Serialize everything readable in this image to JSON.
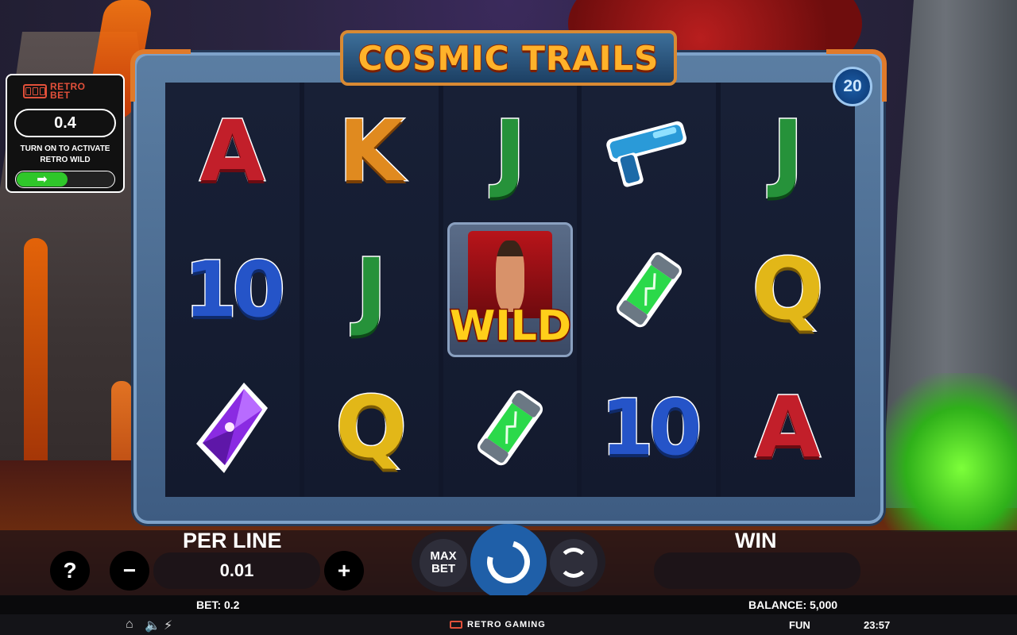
{
  "game": {
    "title": "COSMIC TRAILS",
    "lines": "20"
  },
  "retro_panel": {
    "brand_line1": "RETRO",
    "brand_line2": "BET",
    "value": "0.4",
    "note_line1": "TURN ON TO ACTIVATE",
    "note_line2": "RETRO WILD",
    "toggle_arrow": "➡"
  },
  "reels": [
    [
      "A",
      "10",
      "gem-icon"
    ],
    [
      "K",
      "J",
      "Q"
    ],
    [
      "J",
      "WILD",
      "canister-icon"
    ],
    [
      "blaster-icon",
      "canister-icon",
      "10"
    ],
    [
      "J",
      "Q",
      "A"
    ]
  ],
  "wild_label": "WILD",
  "controls": {
    "per_line_label": "PER LINE",
    "per_line_value": "0.01",
    "help": "?",
    "minus": "−",
    "plus": "+",
    "max_bet_line1": "MAX",
    "max_bet_line2": "BET",
    "win_label": "WIN",
    "win_value": ""
  },
  "info": {
    "bet": "BET: 0.2",
    "balance": "BALANCE: 5,000"
  },
  "footer": {
    "brand": "RETRO GAMING",
    "mode": "FUN",
    "time": "23:57"
  }
}
